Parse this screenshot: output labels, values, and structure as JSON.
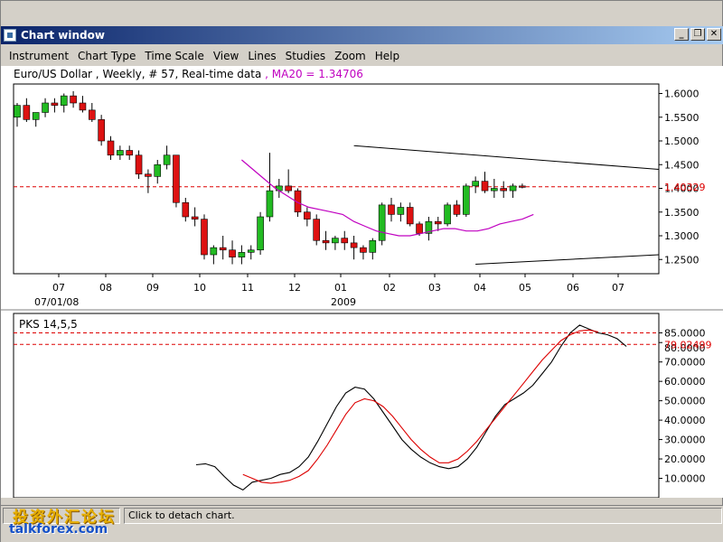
{
  "window": {
    "title": "Chart window",
    "controls": {
      "minimize": "_",
      "restore": "❐",
      "close": "✕"
    }
  },
  "menu": [
    "Instrument",
    "Chart Type",
    "Time Scale",
    "View",
    "Lines",
    "Studies",
    "Zoom",
    "Help"
  ],
  "info": {
    "instrument": "Euro/US Dollar , Weekly, # 57, Real-time data",
    "ma_label": ", MA20 = 1.34706"
  },
  "colors": {
    "bull": "#22bb22",
    "bear": "#dd1111",
    "ma": "#c000c0",
    "indicator_main": "#000000",
    "indicator_signal": "#dd0000",
    "dash": "#dd0000"
  },
  "chart_data": [
    {
      "type": "candlestick",
      "ylim": [
        1.22,
        1.62
      ],
      "y_ticks": [
        "1.6000",
        "1.5500",
        "1.5000",
        "1.4500",
        "1.4000",
        "1.3500",
        "1.3000",
        "1.2500"
      ],
      "current_price": "1.40329",
      "x_ticks": [
        "07",
        "08",
        "09",
        "10",
        "11",
        "12",
        "01",
        "02",
        "03",
        "04",
        "05",
        "06",
        "07"
      ],
      "x_subtitles": [
        "07/01/08",
        "2009"
      ],
      "ma20": [
        1.46,
        1.44,
        1.42,
        1.4,
        1.385,
        1.37,
        1.36,
        1.355,
        1.35,
        1.345,
        1.33,
        1.32,
        1.31,
        1.305,
        1.3,
        1.3,
        1.305,
        1.31,
        1.315,
        1.315,
        1.31,
        1.31,
        1.315,
        1.325,
        1.33,
        1.335,
        1.345
      ],
      "candles": [
        [
          1.55,
          1.58,
          1.53,
          1.575
        ],
        [
          1.575,
          1.59,
          1.54,
          1.545
        ],
        [
          1.545,
          1.56,
          1.53,
          1.56
        ],
        [
          1.56,
          1.59,
          1.55,
          1.58
        ],
        [
          1.58,
          1.59,
          1.56,
          1.575
        ],
        [
          1.575,
          1.6,
          1.56,
          1.595
        ],
        [
          1.595,
          1.605,
          1.57,
          1.58
        ],
        [
          1.58,
          1.595,
          1.56,
          1.565
        ],
        [
          1.565,
          1.58,
          1.54,
          1.545
        ],
        [
          1.545,
          1.555,
          1.49,
          1.5
        ],
        [
          1.5,
          1.51,
          1.46,
          1.47
        ],
        [
          1.47,
          1.49,
          1.46,
          1.48
        ],
        [
          1.48,
          1.49,
          1.46,
          1.47
        ],
        [
          1.47,
          1.48,
          1.42,
          1.43
        ],
        [
          1.43,
          1.44,
          1.39,
          1.425
        ],
        [
          1.425,
          1.46,
          1.41,
          1.45
        ],
        [
          1.45,
          1.49,
          1.44,
          1.47
        ],
        [
          1.47,
          1.47,
          1.36,
          1.37
        ],
        [
          1.37,
          1.38,
          1.33,
          1.34
        ],
        [
          1.34,
          1.36,
          1.32,
          1.335
        ],
        [
          1.335,
          1.345,
          1.25,
          1.26
        ],
        [
          1.26,
          1.28,
          1.24,
          1.275
        ],
        [
          1.275,
          1.3,
          1.25,
          1.27
        ],
        [
          1.27,
          1.29,
          1.24,
          1.255
        ],
        [
          1.255,
          1.28,
          1.24,
          1.265
        ],
        [
          1.265,
          1.28,
          1.25,
          1.27
        ],
        [
          1.27,
          1.35,
          1.26,
          1.34
        ],
        [
          1.34,
          1.475,
          1.33,
          1.395
        ],
        [
          1.395,
          1.42,
          1.38,
          1.405
        ],
        [
          1.405,
          1.44,
          1.39,
          1.395
        ],
        [
          1.395,
          1.4,
          1.34,
          1.35
        ],
        [
          1.35,
          1.36,
          1.32,
          1.335
        ],
        [
          1.335,
          1.345,
          1.28,
          1.29
        ],
        [
          1.29,
          1.31,
          1.27,
          1.285
        ],
        [
          1.285,
          1.3,
          1.27,
          1.295
        ],
        [
          1.295,
          1.31,
          1.27,
          1.285
        ],
        [
          1.285,
          1.3,
          1.25,
          1.275
        ],
        [
          1.275,
          1.28,
          1.25,
          1.265
        ],
        [
          1.265,
          1.295,
          1.25,
          1.29
        ],
        [
          1.29,
          1.37,
          1.28,
          1.365
        ],
        [
          1.365,
          1.38,
          1.33,
          1.345
        ],
        [
          1.345,
          1.37,
          1.33,
          1.36
        ],
        [
          1.36,
          1.37,
          1.32,
          1.325
        ],
        [
          1.325,
          1.33,
          1.3,
          1.305
        ],
        [
          1.305,
          1.34,
          1.29,
          1.33
        ],
        [
          1.33,
          1.34,
          1.31,
          1.325
        ],
        [
          1.325,
          1.37,
          1.32,
          1.365
        ],
        [
          1.365,
          1.375,
          1.34,
          1.345
        ],
        [
          1.345,
          1.41,
          1.34,
          1.405
        ],
        [
          1.405,
          1.425,
          1.39,
          1.415
        ],
        [
          1.415,
          1.435,
          1.39,
          1.395
        ],
        [
          1.395,
          1.42,
          1.38,
          1.4
        ],
        [
          1.4,
          1.415,
          1.38,
          1.395
        ],
        [
          1.395,
          1.41,
          1.38,
          1.405
        ],
        [
          1.405,
          1.41,
          1.4,
          1.403
        ]
      ],
      "trendlines": [
        {
          "from": [
            37,
            1.49
          ],
          "to": [
            140,
            1.44
          ]
        },
        {
          "from": [
            50,
            1.24
          ],
          "to": [
            140,
            1.26
          ]
        }
      ]
    },
    {
      "type": "line",
      "label": "PKS 14,5,5",
      "ylim": [
        0,
        95
      ],
      "y_ticks": [
        "85.0000",
        "80.0000",
        "70.0000",
        "60.0000",
        "50.0000",
        "40.0000",
        "30.0000",
        "20.0000",
        "10.0000"
      ],
      "levels": {
        "upper": 85,
        "lower": 79.02499,
        "lower_label": "79.02499"
      },
      "series": [
        {
          "color": "#000000",
          "start": 0,
          "values": [
            17,
            17.5,
            16,
            11,
            6.5,
            4,
            8,
            9,
            10,
            12,
            13,
            16,
            21,
            29,
            38,
            47,
            54,
            57,
            56,
            51,
            44,
            37,
            30,
            25,
            21,
            18,
            16,
            15,
            16,
            20,
            26,
            34,
            42,
            48,
            51,
            54,
            58,
            64,
            70,
            78,
            85,
            89,
            87,
            85,
            84,
            82,
            78
          ]
        },
        {
          "color": "#dd0000",
          "start": 5,
          "values": [
            12,
            10,
            8,
            7.5,
            8,
            9,
            11,
            14,
            20,
            27,
            35,
            43,
            49,
            51,
            50,
            47,
            42,
            36,
            30,
            25,
            21,
            18,
            18,
            20,
            24,
            29,
            35,
            41,
            47,
            53,
            59,
            65,
            71,
            76,
            81,
            84,
            86,
            86.5,
            85.5
          ]
        }
      ]
    }
  ],
  "status": {
    "text": "Click to detach chart."
  },
  "watermark": {
    "line1": "投资外汇论坛",
    "line2": "talkforex.com"
  }
}
